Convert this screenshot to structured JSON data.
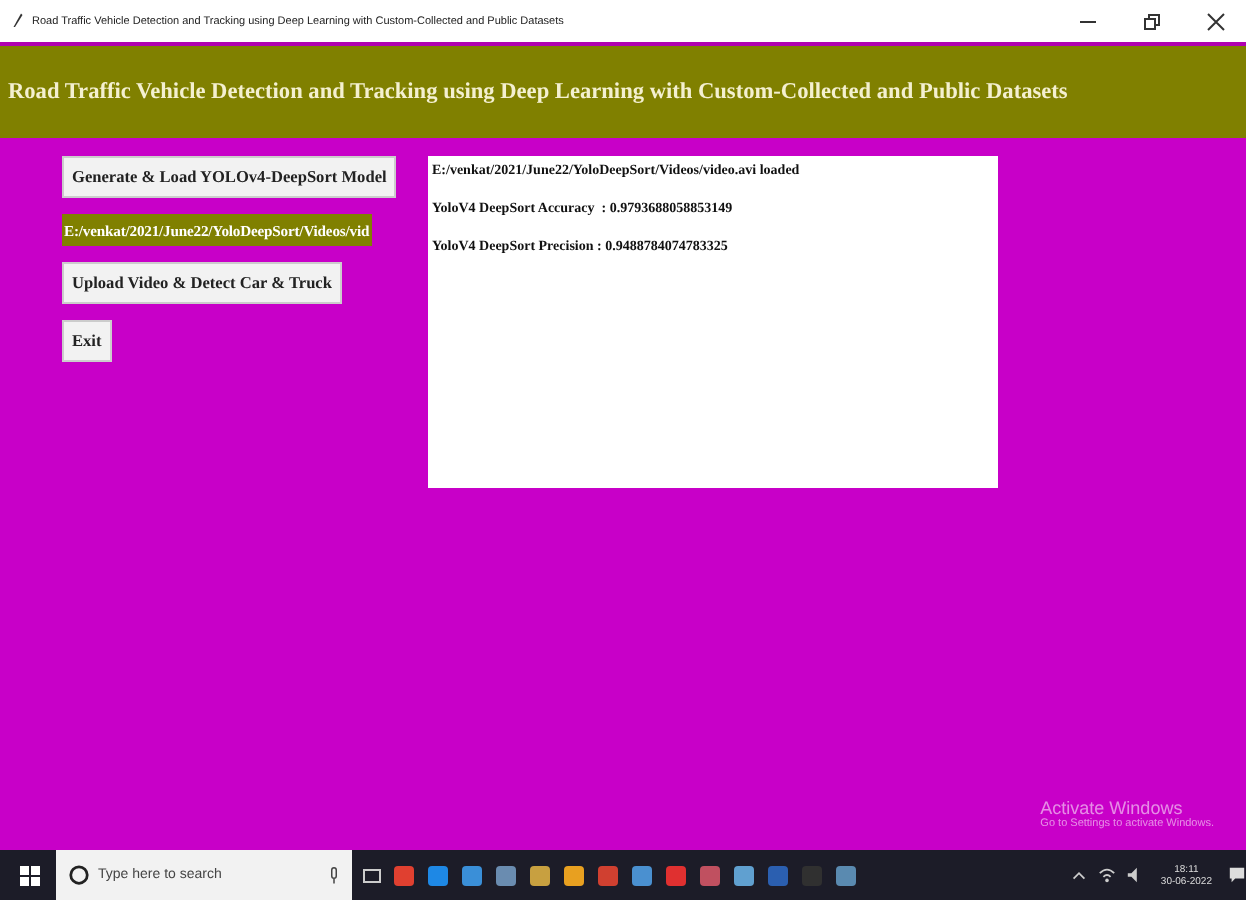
{
  "window": {
    "title": "Road Traffic Vehicle Detection and Tracking using Deep Learning with Custom-Collected and Public Datasets"
  },
  "header": {
    "title": "Road Traffic Vehicle Detection and Tracking using Deep Learning with Custom-Collected and Public Datasets"
  },
  "controls": [
    {
      "kind": "button",
      "label": "Generate & Load YOLOv4-DeepSort Model"
    },
    {
      "kind": "label",
      "label": "E:/venkat/2021/June22/YoloDeepSort/Videos/vid"
    },
    {
      "kind": "button",
      "label": "Upload Video & Detect Car & Truck"
    },
    {
      "kind": "button",
      "label": "Exit"
    }
  ],
  "output": {
    "lines": [
      "E:/venkat/2021/June22/YoloDeepSort/Videos/video.avi loaded",
      "YoloV4 DeepSort Accuracy  : 0.9793688058853149",
      "YoloV4 DeepSort Precision : 0.9488784074783325"
    ]
  },
  "activation": {
    "title": "Activate Windows",
    "message": "Go to Settings to activate Windows."
  },
  "taskbar": {
    "search_placeholder": "Type here to search",
    "time": "18:11",
    "date": "30-06-2022"
  }
}
